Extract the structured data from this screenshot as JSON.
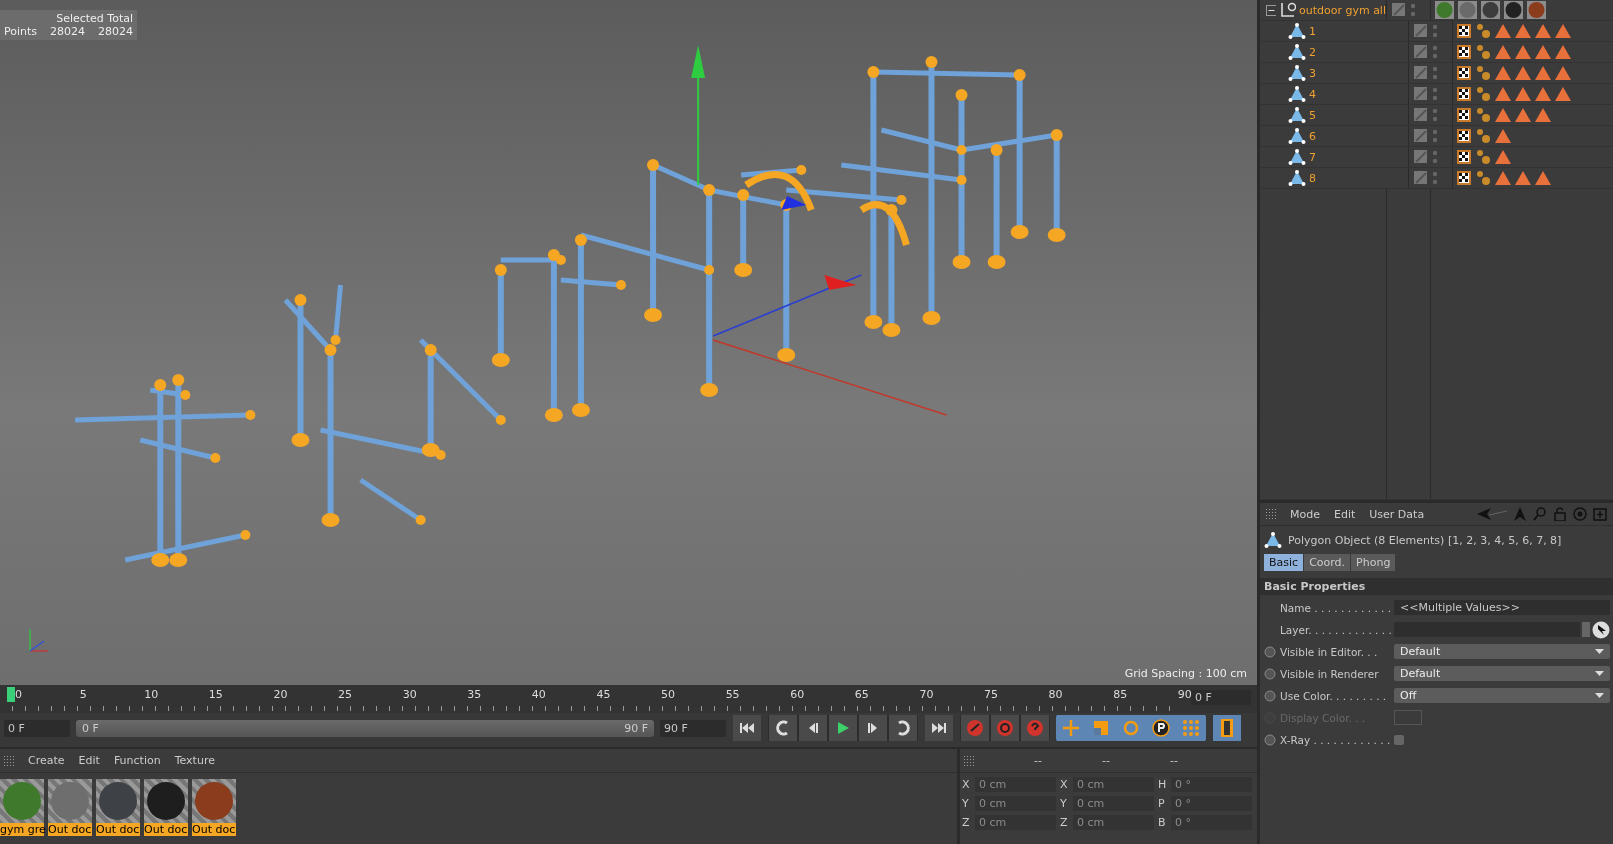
{
  "viewport": {
    "stats": {
      "header": "Selected Total",
      "row_label": "Points",
      "selected": "28024",
      "total": "28024"
    },
    "grid_spacing": "Grid Spacing : 100 cm"
  },
  "object_manager": {
    "root": {
      "name": "outdoor gym all",
      "expanded": true,
      "materials": [
        {
          "color": "#3f7a2c"
        },
        {
          "color": "#6a6a6a"
        },
        {
          "color": "#3c3c3c"
        },
        {
          "color": "#222222"
        },
        {
          "color": "#8a3c1c"
        }
      ]
    },
    "children": [
      {
        "name": "1",
        "tags": [
          {
            "kind": "texture"
          },
          {
            "kind": "phong"
          },
          {
            "kind": "material"
          },
          {
            "kind": "material"
          },
          {
            "kind": "material"
          },
          {
            "kind": "material"
          }
        ]
      },
      {
        "name": "2",
        "tags": [
          {
            "kind": "texture"
          },
          {
            "kind": "phong"
          },
          {
            "kind": "material"
          },
          {
            "kind": "material"
          },
          {
            "kind": "material"
          },
          {
            "kind": "material"
          }
        ]
      },
      {
        "name": "3",
        "tags": [
          {
            "kind": "texture"
          },
          {
            "kind": "phong"
          },
          {
            "kind": "material"
          },
          {
            "kind": "material"
          },
          {
            "kind": "material"
          },
          {
            "kind": "material"
          }
        ]
      },
      {
        "name": "4",
        "tags": [
          {
            "kind": "texture"
          },
          {
            "kind": "phong"
          },
          {
            "kind": "material"
          },
          {
            "kind": "material"
          },
          {
            "kind": "material"
          },
          {
            "kind": "material"
          }
        ]
      },
      {
        "name": "5",
        "tags": [
          {
            "kind": "texture"
          },
          {
            "kind": "phong"
          },
          {
            "kind": "material"
          },
          {
            "kind": "material"
          },
          {
            "kind": "material"
          }
        ]
      },
      {
        "name": "6",
        "tags": [
          {
            "kind": "texture"
          },
          {
            "kind": "phong"
          },
          {
            "kind": "material"
          }
        ]
      },
      {
        "name": "7",
        "tags": [
          {
            "kind": "texture"
          },
          {
            "kind": "phong"
          },
          {
            "kind": "material"
          }
        ]
      },
      {
        "name": "8",
        "tags": [
          {
            "kind": "texture"
          },
          {
            "kind": "phong"
          },
          {
            "kind": "material"
          },
          {
            "kind": "material"
          },
          {
            "kind": "material"
          }
        ]
      }
    ]
  },
  "attributes": {
    "menu": [
      "Mode",
      "Edit",
      "User Data"
    ],
    "title": "Polygon Object (8 Elements) [1, 2, 3, 4, 5, 6, 7, 8]",
    "tabs": [
      {
        "label": "Basic",
        "selected": true
      },
      {
        "label": "Coord.",
        "selected": false
      },
      {
        "label": "Phong",
        "selected": false
      }
    ],
    "section": "Basic Properties",
    "fields": [
      {
        "label": "Name . . . . . . . . . . . .",
        "kind": "text",
        "value": "<<Multiple Values>>",
        "animatable": false,
        "disabled": false
      },
      {
        "label": "Layer. . . . . . . . . . . . .",
        "kind": "link",
        "animatable": false,
        "disabled": false
      },
      {
        "label": "Visible in Editor. . .",
        "kind": "dropdown",
        "value": "Default",
        "animatable": true,
        "disabled": false
      },
      {
        "label": "Visible in Renderer",
        "kind": "dropdown",
        "value": "Default",
        "animatable": true,
        "disabled": false
      },
      {
        "label": "Use Color. . . . . . . . .",
        "kind": "dropdown",
        "value": "Off",
        "animatable": true,
        "disabled": false
      },
      {
        "label": "Display Color. . .",
        "kind": "color",
        "animatable": true,
        "disabled": true
      },
      {
        "label": "X-Ray . . . . . . . . . . . .",
        "kind": "checkbox",
        "checked": false,
        "animatable": true,
        "disabled": false
      }
    ]
  },
  "timeline": {
    "ticks": [
      "0",
      "5",
      "10",
      "15",
      "20",
      "25",
      "30",
      "35",
      "40",
      "45",
      "50",
      "55",
      "60",
      "65",
      "70",
      "75",
      "80",
      "85",
      "90"
    ],
    "current_frame": "0 F",
    "range": {
      "level": 1
    },
    "start": "0 F",
    "range_start": "0 F",
    "range_end": "90 F",
    "end": "90 F"
  },
  "material_manager": {
    "menu": [
      "Create",
      "Edit",
      "Function",
      "Texture"
    ],
    "materials": [
      {
        "name": "gym gre",
        "color": "#3f7a2c",
        "selected": true
      },
      {
        "name": "Out doc",
        "color": "#6e6e6e",
        "selected": true
      },
      {
        "name": "Out doc",
        "color": "#3e4246",
        "selected": true
      },
      {
        "name": "Out doc",
        "color": "#1e1e1e",
        "selected": true
      },
      {
        "name": "Out doc",
        "color": "#8a3c1c",
        "selected": true
      }
    ]
  },
  "coordinates": {
    "headers": [
      "--",
      "--",
      "--"
    ],
    "columns": [
      [
        {
          "axis": "X",
          "value": "0 cm"
        },
        {
          "axis": "Y",
          "value": "0 cm"
        },
        {
          "axis": "Z",
          "value": "0 cm"
        }
      ],
      [
        {
          "axis": "X",
          "value": "0 cm"
        },
        {
          "axis": "Y",
          "value": "0 cm"
        },
        {
          "axis": "Z",
          "value": "0 cm"
        }
      ],
      [
        {
          "axis": "H",
          "value": "0 °"
        },
        {
          "axis": "P",
          "value": "0 °"
        },
        {
          "axis": "B",
          "value": "0 °"
        }
      ]
    ]
  }
}
